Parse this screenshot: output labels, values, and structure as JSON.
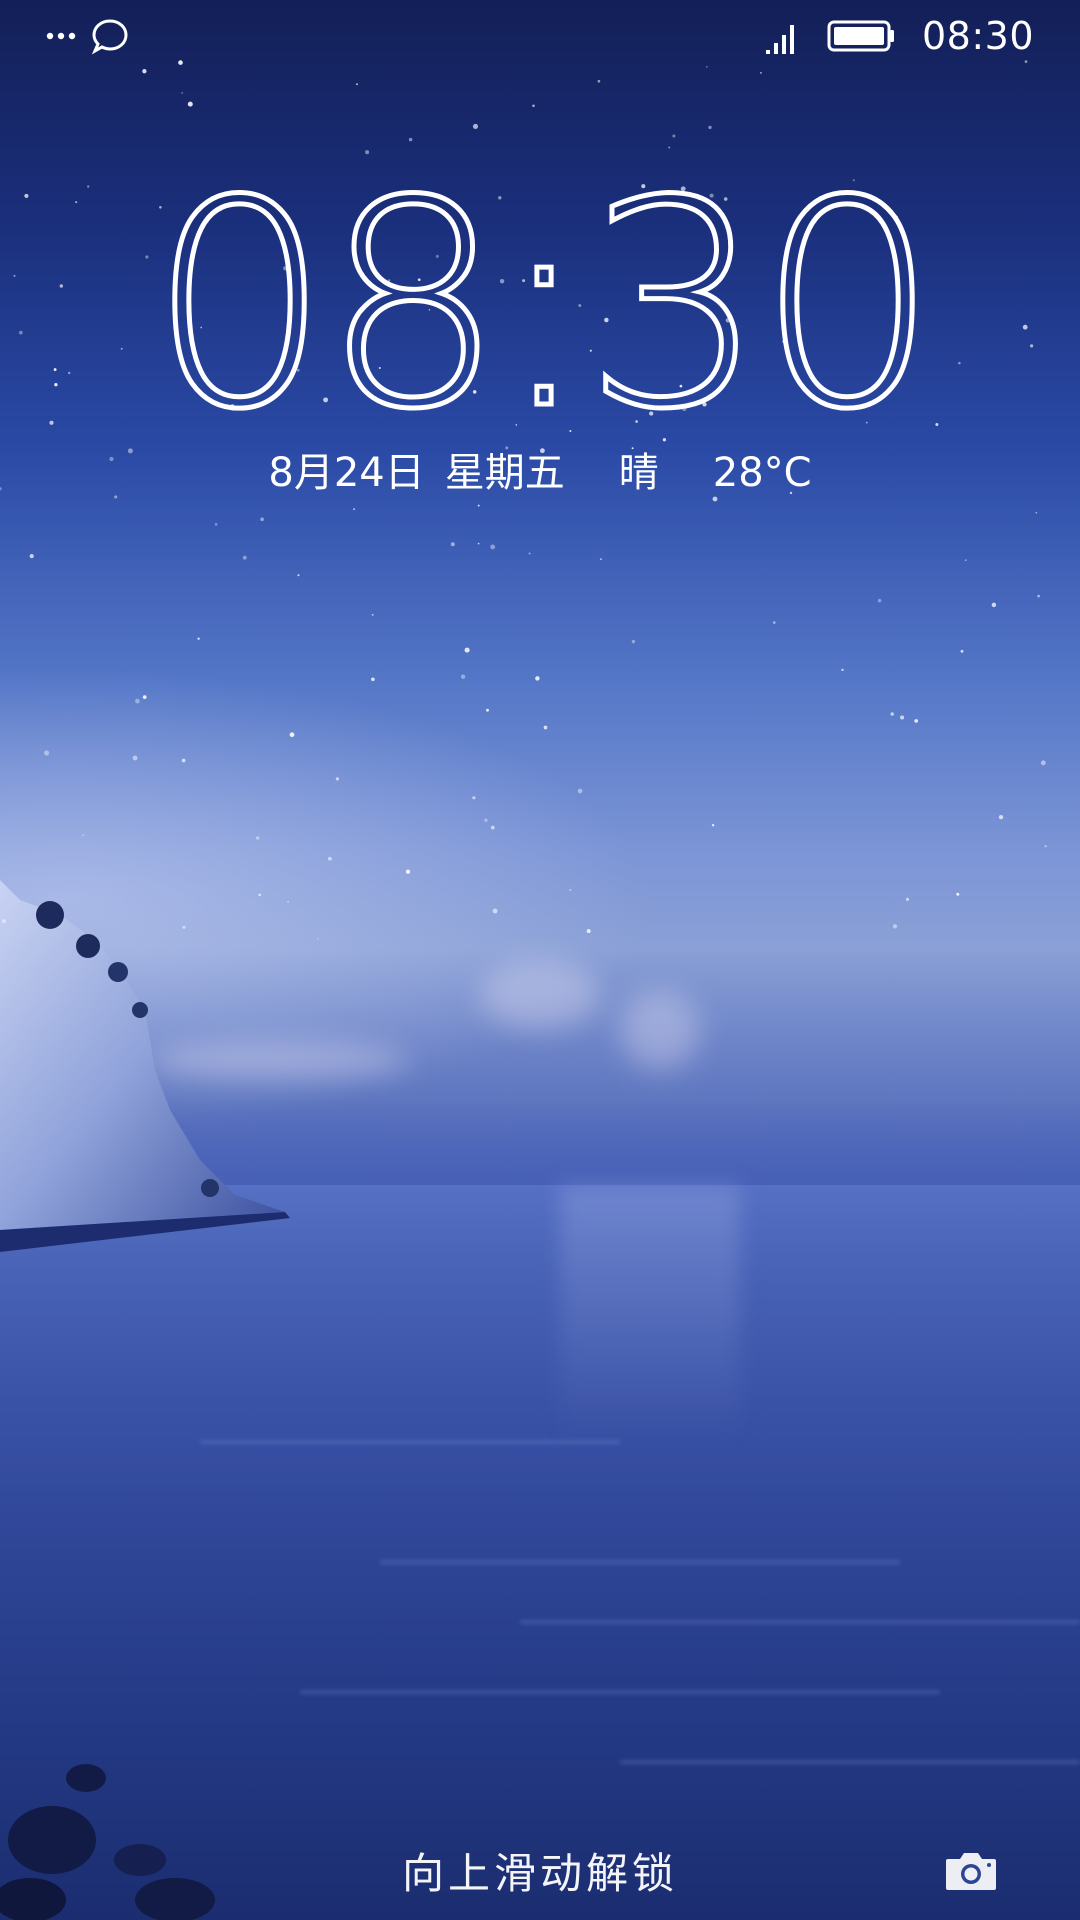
{
  "status_bar": {
    "left_icons": [
      "more-icon",
      "message-bubble-icon"
    ],
    "right_icons": [
      "signal-icon",
      "battery-icon"
    ],
    "time": "08:30"
  },
  "lock_screen": {
    "clock": "08:30",
    "date": "8月24日",
    "weekday": "星期五",
    "weather": "晴",
    "temperature": "28°C",
    "unlock_hint": "向上滑动解锁",
    "camera_icon": "camera-icon"
  },
  "colors": {
    "text": "#ffffff",
    "sky_top": "#131f57",
    "sea": "#2e4596"
  }
}
